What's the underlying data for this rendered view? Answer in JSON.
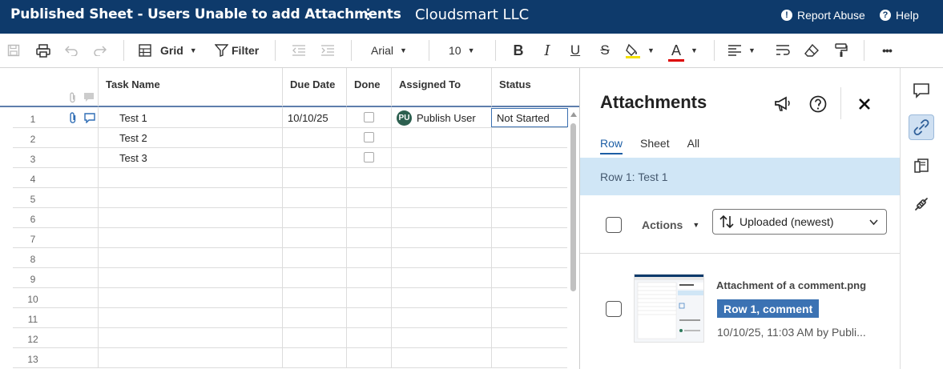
{
  "header": {
    "sheet_title": "Published Sheet - Users Unable to add Attachments",
    "kebab": "⋮",
    "org_name": "Cloudsmart LLC",
    "report_abuse": "Report Abuse",
    "help": "Help",
    "bg_color": "#0e3a6b"
  },
  "toolbar": {
    "view_label": "Grid",
    "filter_label": "Filter",
    "font_family": "Arial",
    "font_size": "10",
    "more": "•••",
    "bold": "B",
    "italic": "I",
    "underline": "U",
    "strike": "S",
    "text_color": "A"
  },
  "grid": {
    "columns": [
      "Task Name",
      "Due Date",
      "Done",
      "Assigned To",
      "Status"
    ],
    "rows": [
      {
        "num": "1",
        "task": "Test 1",
        "due": "10/10/25",
        "assigned": "Publish User",
        "initials": "PU",
        "status": "Not Started"
      },
      {
        "num": "2",
        "task": "Test 2",
        "due": "",
        "assigned": "",
        "initials": "",
        "status": ""
      },
      {
        "num": "3",
        "task": "Test 3",
        "due": "",
        "assigned": "",
        "initials": "",
        "status": ""
      },
      {
        "num": "4",
        "task": "",
        "due": "",
        "assigned": "",
        "initials": "",
        "status": ""
      },
      {
        "num": "5",
        "task": "",
        "due": "",
        "assigned": "",
        "initials": "",
        "status": ""
      },
      {
        "num": "6",
        "task": "",
        "due": "",
        "assigned": "",
        "initials": "",
        "status": ""
      },
      {
        "num": "7",
        "task": "",
        "due": "",
        "assigned": "",
        "initials": "",
        "status": ""
      },
      {
        "num": "8",
        "task": "",
        "due": "",
        "assigned": "",
        "initials": "",
        "status": ""
      },
      {
        "num": "9",
        "task": "",
        "due": "",
        "assigned": "",
        "initials": "",
        "status": ""
      },
      {
        "num": "10",
        "task": "",
        "due": "",
        "assigned": "",
        "initials": "",
        "status": ""
      },
      {
        "num": "11",
        "task": "",
        "due": "",
        "assigned": "",
        "initials": "",
        "status": ""
      },
      {
        "num": "12",
        "task": "",
        "due": "",
        "assigned": "",
        "initials": "",
        "status": ""
      },
      {
        "num": "13",
        "task": "",
        "due": "",
        "assigned": "",
        "initials": "",
        "status": ""
      }
    ]
  },
  "attachments": {
    "title": "Attachments",
    "tabs": [
      "Row",
      "Sheet",
      "All"
    ],
    "active_tab": "Row",
    "row_context": "Row 1: Test 1",
    "actions_label": "Actions",
    "sort_value": "Uploaded (newest)",
    "file": {
      "name": "Attachment of a comment.png",
      "badge": "Row 1, comment",
      "meta": "10/10/25, 11:03 AM by Publi..."
    }
  }
}
